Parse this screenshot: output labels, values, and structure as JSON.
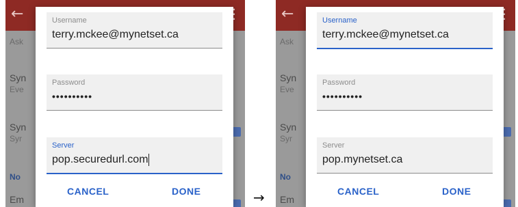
{
  "icons": {
    "back": "arrow-left-icon",
    "more": "more-vert-icon",
    "transition": "arrow-right-icon"
  },
  "colors": {
    "appbar": "#8e2a24",
    "accent": "#2a62c9"
  },
  "background": {
    "row1_sub": "Ask",
    "row2_title": "Syn",
    "row2_sub": "Eve",
    "row3_title": "Syn",
    "row3_sub": "Syr",
    "section": "No",
    "row4_title": "Em"
  },
  "left": {
    "username_label": "Username",
    "username_value": "terry.mckee@mynetset.ca",
    "password_label": "Password",
    "password_value": "••••••••••",
    "server_label": "Server",
    "server_value": "pop.securedurl.com",
    "cancel": "CANCEL",
    "done": "DONE"
  },
  "right": {
    "username_label": "Username",
    "username_value": "terry.mckee@mynetset.ca",
    "password_label": "Password",
    "password_value": "••••••••••",
    "server_label": "Server",
    "server_value": "pop.mynetset.ca",
    "cancel": "CANCEL",
    "done": "DONE"
  },
  "transition_glyph": "→"
}
